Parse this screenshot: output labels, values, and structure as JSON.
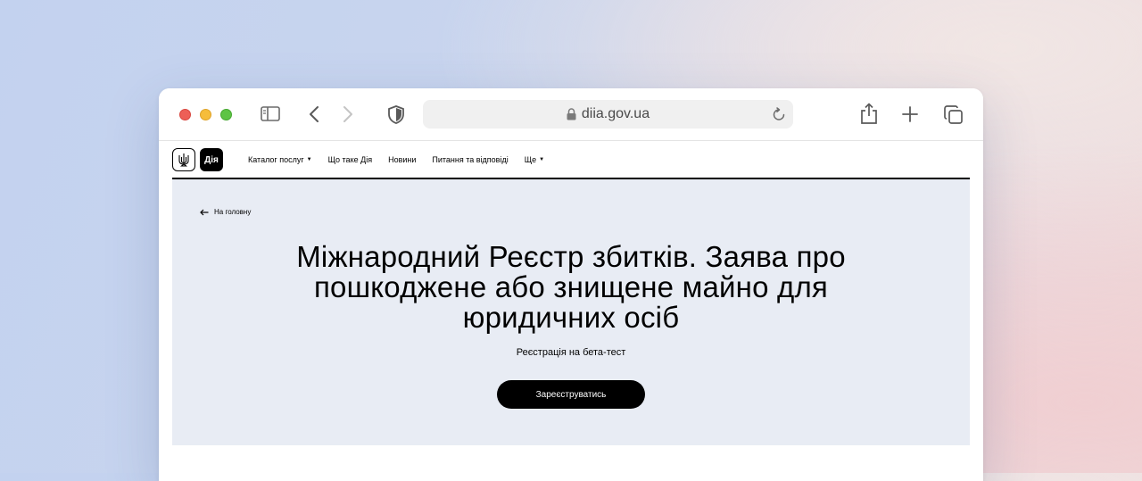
{
  "browser": {
    "url": "diia.gov.ua",
    "icons": [
      "sidebar-icon",
      "back-arrow-icon",
      "forward-arrow-icon",
      "shield-icon",
      "lock-icon",
      "reload-icon",
      "share-icon",
      "plus-icon",
      "tabs-icon"
    ]
  },
  "site": {
    "logo_text": "Дія",
    "nav": [
      {
        "label": "Каталог послуг",
        "dropdown": true
      },
      {
        "label": "Що таке Дія",
        "dropdown": false
      },
      {
        "label": "Новини",
        "dropdown": false
      },
      {
        "label": "Питання та відповіді",
        "dropdown": false
      },
      {
        "label": "Ще",
        "dropdown": true
      }
    ]
  },
  "hero": {
    "back_label": "На головну",
    "title": "Міжнародний Реєстр збитків. Заява про пошкоджене або знищене майно для юридичних осіб",
    "subtitle": "Реєстрація на бета-тест",
    "cta_label": "Зареєструватись"
  },
  "colors": {
    "hero_bg": "#e8ecf4",
    "cta_bg": "#000000"
  }
}
